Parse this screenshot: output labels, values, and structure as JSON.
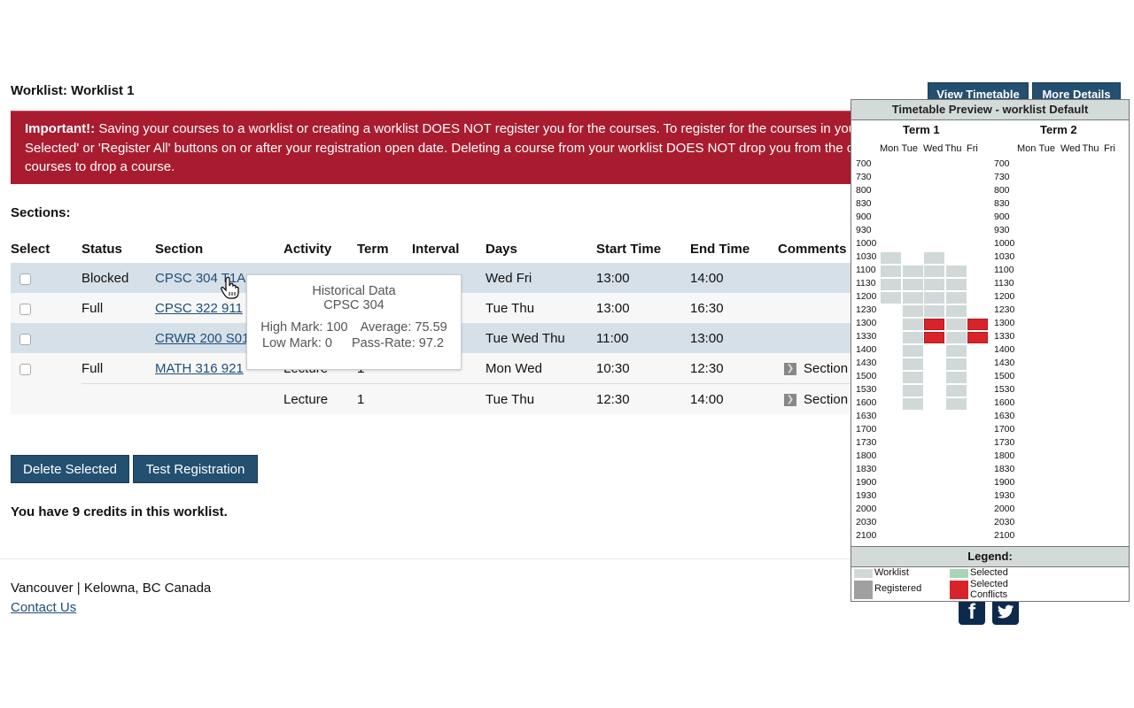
{
  "page": {
    "worklist_title": "Worklist: Worklist 1",
    "alert": {
      "label": "Important!:",
      "text": " Saving your courses to a worklist or creating a worklist DOES NOT register you for the courses. To register for the courses in your worklist, use the 'Register Selected' or 'Register All' buttons on or after your registration open date. Deleting a course from your worklist DOES NOT drop you from the courses. Go to your registered courses to drop a course.",
      "line1": " Saving your courses to a worklist or creating a worklist DOES NOT register you for the courses. To register for the courses in you",
      "line2": "Selected' or 'Register All' buttons on or after your registration open date. Deleting a course from your worklist DOES NOT drop you from the c",
      "line3": "courses to drop a course."
    },
    "sections_label": "Sections:",
    "top_buttons": {
      "view_timetable": "View Timetable",
      "more_details": "More Details"
    }
  },
  "table": {
    "headers": [
      "Select",
      "Status",
      "Section",
      "Activity",
      "Term",
      "Interval",
      "Days",
      "Start Time",
      "End Time",
      "Comments"
    ],
    "rows": [
      {
        "status": "Blocked",
        "section": "CPSC 304 T1A",
        "activity": "",
        "term": "",
        "interval": "",
        "days": "Wed Fri",
        "start": "13:00",
        "end": "14:00",
        "comment": ""
      },
      {
        "status": "Full",
        "section": "CPSC 322 911",
        "activity": "",
        "term": "",
        "interval": "",
        "days": "Tue Thu",
        "start": "13:00",
        "end": "16:30",
        "comment": ""
      },
      {
        "status": "",
        "section": "CRWR 200 S01",
        "activity": "",
        "term": "",
        "interval": "",
        "days": "Tue Wed Thu",
        "start": "11:00",
        "end": "13:00",
        "comment": ""
      },
      {
        "status": "Full",
        "section": "MATH 316 921",
        "activity": "Lecture",
        "term": "1",
        "interval": "",
        "days": "Mon Wed",
        "start": "10:30",
        "end": "12:30",
        "comment": "Section"
      },
      {
        "status": "",
        "section": "",
        "activity": "Lecture",
        "term": "1",
        "interval": "",
        "days": "Tue Thu",
        "start": "12:30",
        "end": "14:00",
        "comment": "Section"
      }
    ]
  },
  "tooltip": {
    "title": "Historical Data",
    "course": "CPSC 304",
    "high_mark": "High Mark: 100",
    "average": "Average: 75.59",
    "low_mark": "Low Mark: 0",
    "pass_rate": "Pass-Rate: 97.2"
  },
  "actions": {
    "delete_selected": "Delete Selected",
    "test_registration": "Test Registration"
  },
  "credits_text": "You have 9 credits in this worklist.",
  "footer": {
    "address": "Vancouver | Kelowna, BC Canada",
    "contact": "Contact Us",
    "social": [
      "facebook",
      "twitter"
    ]
  },
  "timetable": {
    "title": "Timetable Preview - worklist Default",
    "terms": [
      {
        "label": "Term 1"
      },
      {
        "label": "Term 2"
      }
    ],
    "days": [
      "Mon",
      "Tue",
      "Wed",
      "Thu",
      "Fri"
    ],
    "times": [
      "700",
      "730",
      "800",
      "830",
      "900",
      "930",
      "1000",
      "1030",
      "1100",
      "1130",
      "1200",
      "1230",
      "1300",
      "1330",
      "1400",
      "1430",
      "1500",
      "1530",
      "1600",
      "1630",
      "1700",
      "1730",
      "1800",
      "1830",
      "1900",
      "1930",
      "2000",
      "2030",
      "2100"
    ],
    "term1_blocks": {
      "Mon": {
        "worklist": [
          "1030",
          "1100",
          "1130",
          "1200"
        ],
        "conflict": []
      },
      "Tue": {
        "worklist": [
          "1100",
          "1130",
          "1200",
          "1230",
          "1300",
          "1330",
          "1400",
          "1430",
          "1500",
          "1530",
          "1600"
        ],
        "conflict": []
      },
      "Wed": {
        "worklist": [
          "1030",
          "1100",
          "1130",
          "1200",
          "1230"
        ],
        "conflict": [
          "1300",
          "1330"
        ]
      },
      "Thu": {
        "worklist": [
          "1100",
          "1130",
          "1200",
          "1230",
          "1300",
          "1330",
          "1400",
          "1430",
          "1500",
          "1530",
          "1600"
        ],
        "conflict": []
      },
      "Fri": {
        "worklist": [],
        "conflict": [
          "1300",
          "1330"
        ]
      }
    },
    "legend": {
      "title": "Legend:",
      "items": [
        {
          "label": "Worklist",
          "color": "#d0d8d8"
        },
        {
          "label": "Selected",
          "color": "#a8d5b5"
        },
        {
          "label": "Registered",
          "color": "#a0a0a0"
        },
        {
          "label": "Selected Conflicts",
          "color": "#d9232b"
        }
      ]
    }
  }
}
